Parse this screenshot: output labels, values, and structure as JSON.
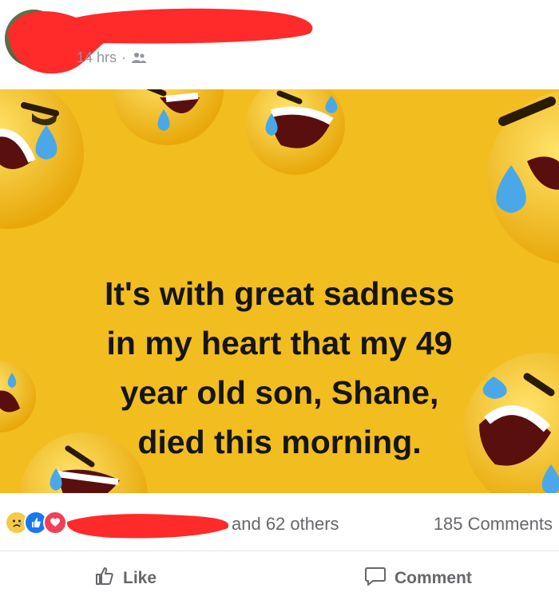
{
  "post": {
    "timestamp": "14 hrs",
    "separator": "·",
    "audience_icon": "friends-icon",
    "image_text_lines": [
      "It's with great sadness",
      "in my heart that my 49",
      "year old son, Shane,",
      "died this morning."
    ],
    "image_background": "#f2bd1f"
  },
  "stats": {
    "reaction_icons": [
      "sad-reaction-icon",
      "like-reaction-icon",
      "love-reaction-icon"
    ],
    "others_text": "and 62 others",
    "comments_text": "185 Comments"
  },
  "actions": {
    "like_label": "Like",
    "comment_label": "Comment"
  },
  "colors": {
    "redaction": "#ff2a2a",
    "muted_text": "#65676b",
    "like_blue": "#1877f2",
    "love_red": "#f33e58"
  }
}
